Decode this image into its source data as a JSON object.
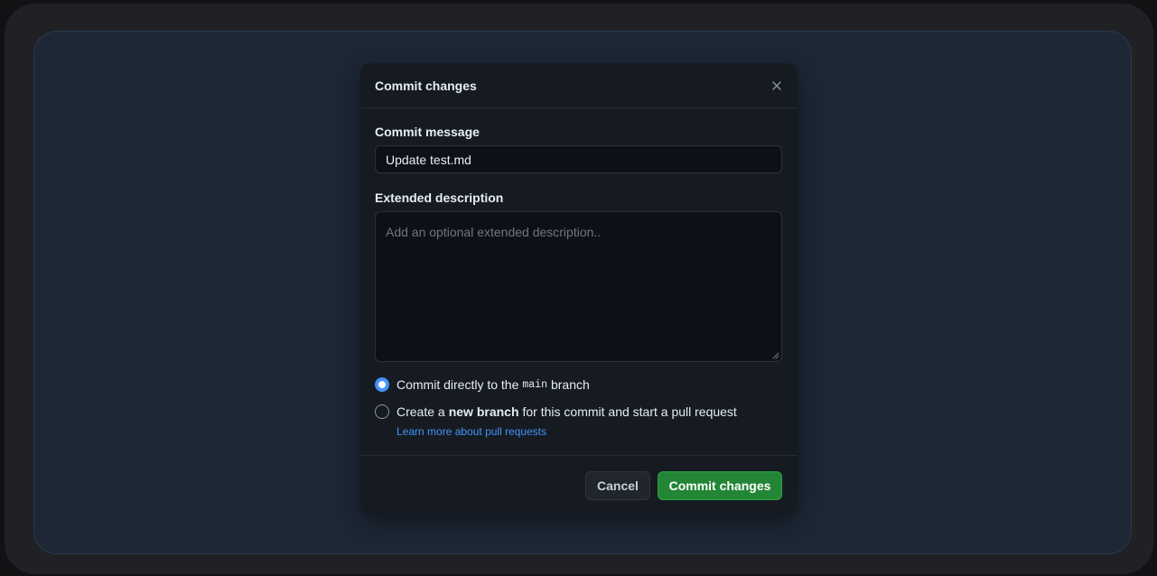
{
  "dialog": {
    "title": "Commit changes",
    "close_icon": "close-icon"
  },
  "commit_message": {
    "label": "Commit message",
    "value": "Update test.md"
  },
  "extended_description": {
    "label": "Extended description",
    "placeholder": "Add an optional extended description..",
    "value": ""
  },
  "branch_options": {
    "direct": {
      "prefix": "Commit directly to the",
      "branch_name": "main",
      "suffix": "branch",
      "selected": true
    },
    "new_branch": {
      "prefix": "Create a",
      "emphasis": "new branch",
      "suffix": "for this commit and start a pull request",
      "selected": false
    },
    "learn_more": "Learn more about pull requests"
  },
  "footer": {
    "cancel_label": "Cancel",
    "commit_label": "Commit changes"
  },
  "colors": {
    "page_background": "#1d2735",
    "dialog_background": "#161b22",
    "accent_blue": "#4493f8",
    "primary_green": "#238636"
  }
}
